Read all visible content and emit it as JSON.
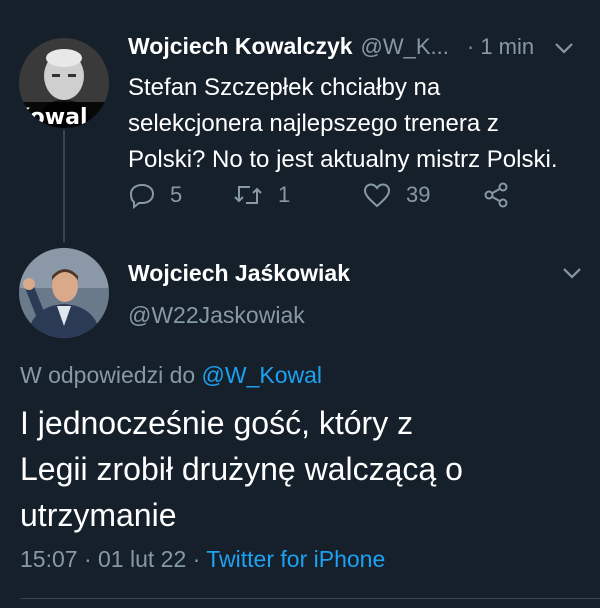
{
  "tweet1": {
    "name": "Wojciech Kowalczyk",
    "handle": "@W_K...",
    "time": "· 1 min",
    "text_lines": [
      "Stefan Szczepłek chciałby na",
      "selekcjonera najlepszego trenera z",
      "Polski? No to jest aktualny mistrz Polski."
    ],
    "avatar_overlay_text": "Kowal",
    "replies": "5",
    "retweets": "1",
    "likes": "39"
  },
  "tweet2": {
    "name": "Wojciech Jaśkowiak",
    "handle": "@W22Jaskowiak",
    "reply_prefix": "W odpowiedzi do",
    "reply_handle": "@W_Kowal",
    "text_lines": [
      "I jednocześnie gość, który z",
      "Legii zrobił drużynę walczącą o",
      "utrzymanie"
    ],
    "timestamp": "15:07 · 01 lut 22",
    "dot": " · ",
    "source": "Twitter for iPhone"
  },
  "colors": {
    "background": "#15202b",
    "muted": "#8899a6",
    "link": "#1da1f2",
    "divider": "#38444d"
  },
  "icons": [
    "reply-icon",
    "retweet-icon",
    "like-icon",
    "share-icon",
    "chevron-down-icon"
  ]
}
